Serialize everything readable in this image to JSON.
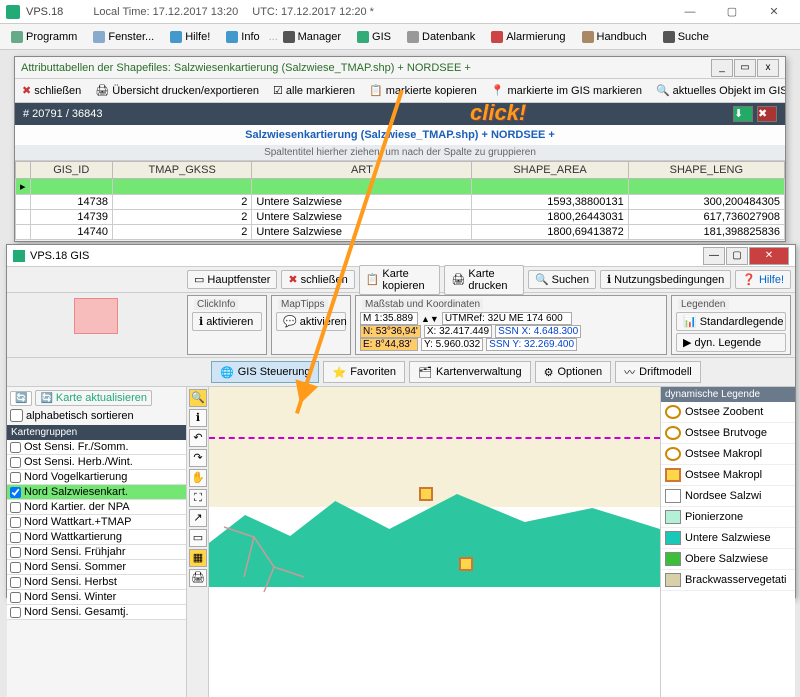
{
  "app": {
    "title": "VPS.18",
    "local_time": "Local Time: 17.12.2017 13:20",
    "utc_time": "UTC: 17.12.2017 12:20  *"
  },
  "menu": [
    "Programm",
    "Fenster...",
    "Hilfe!",
    "Info",
    "...",
    "Manager",
    "GIS",
    "Datenbank",
    "Alarmierung",
    "Handbuch",
    "Suche"
  ],
  "attrwin": {
    "title": "Attributtabellen der Shapefiles: Salzwiesenkartierung (Salzwiese_TMAP.shp) + NORDSEE +",
    "toolbar": [
      "schließen",
      "Übersicht drucken/exportieren",
      "alle markieren",
      "markierte kopieren",
      "markierte im GIS markieren",
      "aktuelles Objekt im GIS finden"
    ],
    "count": "# 20791 / 36843",
    "table_title": "Salzwiesenkartierung (Salzwiese_TMAP.shp) + NORDSEE +",
    "group_hint": "Spaltentitel hierher ziehen, um nach der Spalte zu gruppieren",
    "cols": [
      "GIS_ID",
      "TMAP_GKSS",
      "ART",
      "SHAPE_AREA",
      "SHAPE_LENG"
    ],
    "rows": [
      {
        "gis": "",
        "gk": "",
        "art": "",
        "area": "",
        "leng": "",
        "green": true
      },
      {
        "gis": "14738",
        "gk": "2",
        "art": "Untere Salzwiese",
        "area": "1593,38800131",
        "leng": "300,200484305"
      },
      {
        "gis": "14739",
        "gk": "2",
        "art": "Untere Salzwiese",
        "area": "1800,26443031",
        "leng": "617,736027908"
      },
      {
        "gis": "14740",
        "gk": "2",
        "art": "Untere Salzwiese",
        "area": "1800,69413872",
        "leng": "181,398825836"
      }
    ]
  },
  "giswin": {
    "title": "VPS.18   GIS",
    "toolbar": [
      "Hauptfenster",
      "schließen",
      "Karte kopieren",
      "Karte drucken",
      "Suchen",
      "Nutzungsbedingungen",
      "Hilfe!"
    ],
    "clickinfo": {
      "title": "ClickInfo",
      "btn": "aktivieren"
    },
    "maptipps": {
      "title": "MapTipps",
      "btn": "aktivieren"
    },
    "mass": {
      "title": "Maßstab und Koordinaten",
      "scale": "M 1:35.889",
      "utm": "UTMRef: 32U ME 174 600",
      "n": "N: 53°36,94'",
      "x": "X: 32.417.449",
      "ssnx": "SSN X: 4.648.300",
      "e": "E: 8°44,83'",
      "y": "Y: 5.960.032",
      "ssny": "SSN Y: 32.269.400"
    },
    "legpanel": {
      "title": "Legenden",
      "std": "Standardlegende",
      "dyn": "dyn. Legende"
    },
    "tabs": [
      "GIS Steuerung",
      "Favoriten",
      "Kartenverwaltung",
      "Optionen",
      "Driftmodell"
    ],
    "sidebar": {
      "refresh": "Karte aktualisieren",
      "sort": "alphabetisch sortieren",
      "head": "Kartengruppen",
      "layers": [
        {
          "c": false,
          "t": "Ost Sensi. Fr./Somm."
        },
        {
          "c": false,
          "t": "Ost Sensi. Herb./Wint."
        },
        {
          "c": false,
          "t": "Nord Vogelkartierung"
        },
        {
          "c": true,
          "t": "Nord Salzwiesenkart.",
          "sel": true
        },
        {
          "c": false,
          "t": "Nord Kartier. der NPA"
        },
        {
          "c": false,
          "t": "Nord Wattkart.+TMAP"
        },
        {
          "c": false,
          "t": "Nord Wattkartierung"
        },
        {
          "c": false,
          "t": "Nord Sensi. Frühjahr"
        },
        {
          "c": false,
          "t": "Nord Sensi. Sommer"
        },
        {
          "c": false,
          "t": "Nord Sensi. Herbst"
        },
        {
          "c": false,
          "t": "Nord Sensi. Winter"
        },
        {
          "c": false,
          "t": "Nord Sensi. Gesamtj."
        }
      ]
    },
    "legend": {
      "title": "dynamische Legende",
      "items": [
        {
          "t": "Ostsee Zoobent",
          "c": "#fff",
          "ring": true
        },
        {
          "t": "Ostsee Brutvoge",
          "c": "#fff",
          "ring": true
        },
        {
          "t": "Ostsee Makropl",
          "c": "#fff",
          "ring": true
        },
        {
          "t": "Ostsee Makropl",
          "c": "#ffd54a",
          "box": true
        },
        {
          "t": "Nordsee Salzwi",
          "c": "#fff"
        },
        {
          "t": "Pionierzone",
          "c": "#b4f0d8"
        },
        {
          "t": "Untere Salzwiese",
          "c": "#1bc8b8"
        },
        {
          "t": "Obere Salzwiese",
          "c": "#3bbf3b"
        },
        {
          "t": "Brackwasservegetati",
          "c": "#d8d0a8"
        }
      ]
    }
  },
  "annot": {
    "click": "click!"
  }
}
